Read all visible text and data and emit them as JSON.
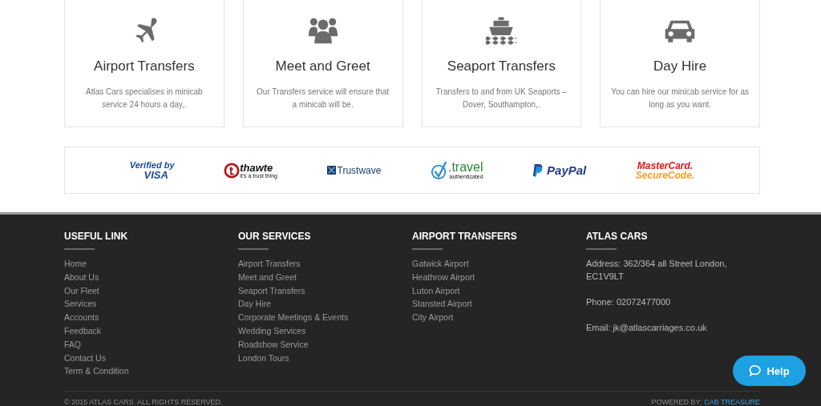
{
  "services": [
    {
      "kind": "plane",
      "title": "Airport Transfers",
      "text": "Atlas Cars specialises in minicab service 24 hours a day,."
    },
    {
      "kind": "people",
      "title": "Meet and Greet",
      "text": "Our Transfers service will ensure that a minicab will be."
    },
    {
      "kind": "ship",
      "title": "Seaport Transfers",
      "text": "Transfers to and from UK Seaports – Dover, Southampton,."
    },
    {
      "kind": "car",
      "title": "Day Hire",
      "text": "You can hire our minicab service for as long as you want."
    }
  ],
  "badges": [
    {
      "kind": "visa",
      "line1": "Verified by",
      "line2": "VISA"
    },
    {
      "kind": "thawte",
      "line1": "thawte",
      "line2": "it's a trust thing"
    },
    {
      "kind": "trustwave",
      "line1": "Trustwave"
    },
    {
      "kind": "travel",
      "line1": ".travel",
      "line2": "authenticated"
    },
    {
      "kind": "paypal",
      "line1": "PayPal"
    },
    {
      "kind": "mastercard",
      "line1": "MasterCard.",
      "line2": "SecureCode."
    }
  ],
  "footer": {
    "columns": [
      {
        "heading": "USEFUL LINK",
        "links": [
          "Home",
          "About Us",
          "Our Fleet",
          "Services",
          "Accounts",
          "Feedback",
          "FAQ",
          "Contact Us",
          "Term & Condition"
        ]
      },
      {
        "heading": "OUR SERVICES",
        "links": [
          "Airport Transfers",
          "Meet and Greet",
          "Seaport Transfers",
          "Day Hire",
          "Corporate Meetings & Events",
          "Wedding Services",
          "Roadshow Service",
          "London Tours"
        ]
      },
      {
        "heading": "AIRPORT TRANSFERS",
        "links": [
          "Gatwick Airport",
          "Heathrow Airport",
          "Luton Airport",
          "Stansted Airport",
          "City Airport"
        ]
      }
    ],
    "contact": {
      "heading": "ATLAS CARS",
      "lines": [
        "Address: 362/364 all Street London, EC1V9LT",
        "Phone: 02072477000",
        "Email: jk@atlascarriages.co.uk"
      ]
    },
    "copyright": "© 2015 ATLAS CARS. ALL RIGHTS RESERVED.",
    "powered_label": "POWERED BY:",
    "powered_link": "CAB TREASURE"
  },
  "help_button": "Help"
}
